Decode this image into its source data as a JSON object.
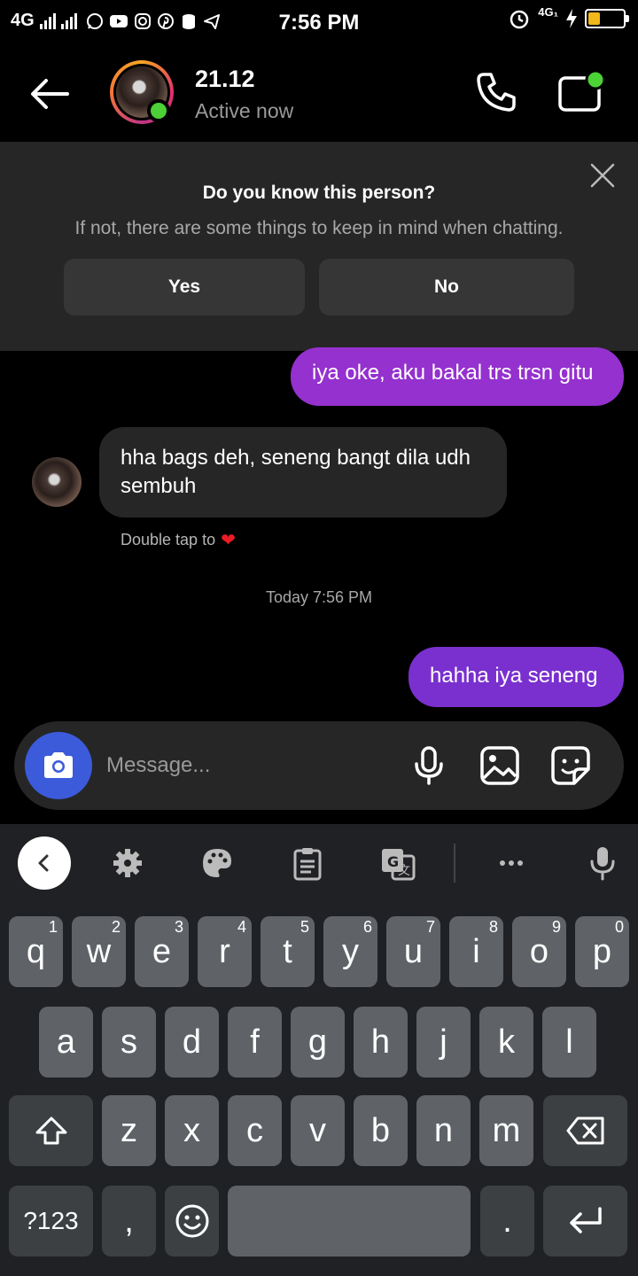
{
  "status_bar": {
    "network": "4G",
    "time": "7:56 PM",
    "right_network": "4G₁",
    "battery_level": 0.35,
    "battery_color": "#f2b81a"
  },
  "header": {
    "contact_name": "21.12",
    "contact_status": "Active now",
    "online_color": "#4cd137"
  },
  "banner": {
    "title": "Do you know this person?",
    "text": "If not, there are some things to keep in mind when chatting.",
    "yes_label": "Yes",
    "no_label": "No"
  },
  "messages": [
    {
      "direction": "sent",
      "text": "iya oke, aku bakal trs trsn gitu"
    },
    {
      "direction": "received",
      "text": "hha bags deh, seneng bangt dila udh sembuh"
    },
    {
      "direction": "sent",
      "text": "hahha iya seneng"
    }
  ],
  "double_tap": "Double tap to",
  "timestamp": "Today 7:56 PM",
  "composer": {
    "placeholder": "Message..."
  },
  "keyboard": {
    "row1": [
      {
        "letter": "q",
        "num": "1"
      },
      {
        "letter": "w",
        "num": "2"
      },
      {
        "letter": "e",
        "num": "3"
      },
      {
        "letter": "r",
        "num": "4"
      },
      {
        "letter": "t",
        "num": "5"
      },
      {
        "letter": "y",
        "num": "6"
      },
      {
        "letter": "u",
        "num": "7"
      },
      {
        "letter": "i",
        "num": "8"
      },
      {
        "letter": "o",
        "num": "9"
      },
      {
        "letter": "p",
        "num": "0"
      }
    ],
    "row2": [
      "a",
      "s",
      "d",
      "f",
      "g",
      "h",
      "j",
      "k",
      "l"
    ],
    "row3": [
      "z",
      "x",
      "c",
      "v",
      "b",
      "n",
      "m"
    ],
    "symbols_label": "?123",
    "comma": ",",
    "period": "."
  }
}
